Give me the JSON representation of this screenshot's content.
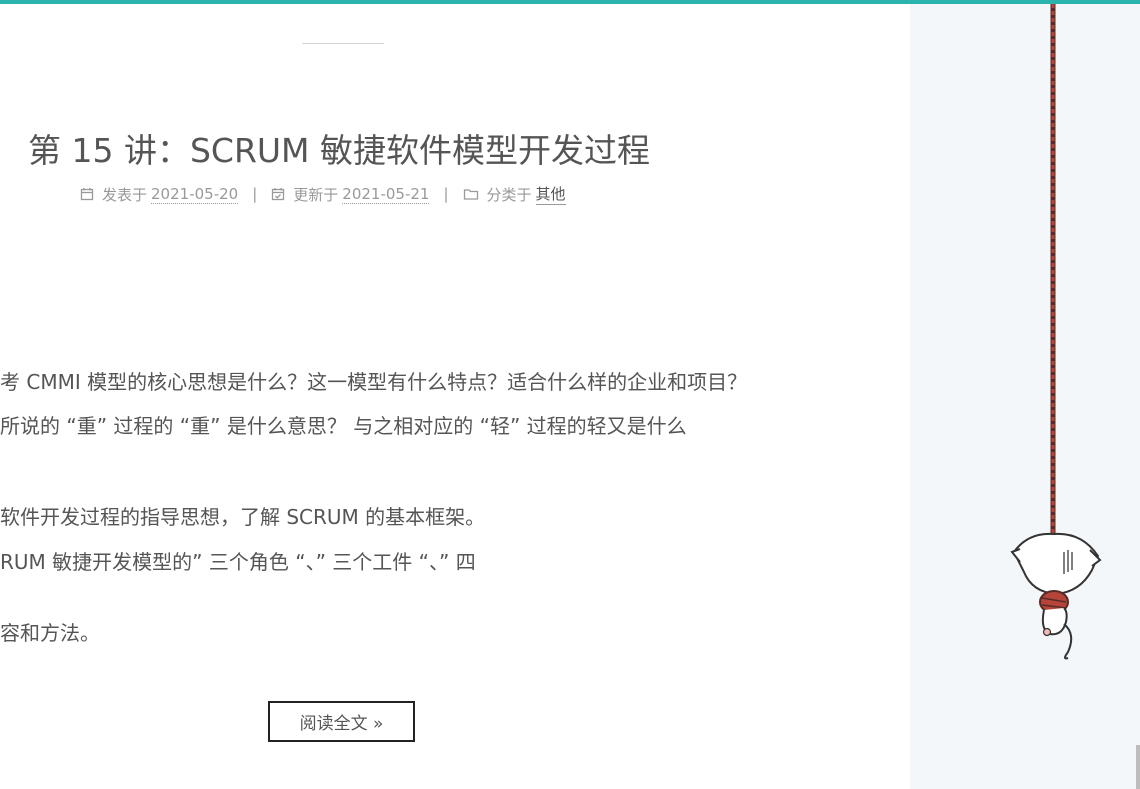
{
  "post": {
    "title": "第 15 讲：SCRUM 敏捷软件模型开发过程",
    "meta": {
      "posted_label": "发表于",
      "posted_date": "2021-05-20",
      "updated_label": "更新于",
      "updated_date": "2021-05-21",
      "category_label": "分类于",
      "category": "其他",
      "separator": "|"
    },
    "excerpt": [
      "考 CMMI 模型的核心思想是什么？这一模型有什么特点？适合什么样的企业和项目？",
      "所说的 “重” 过程的 “重” 是什么意思？ 与之相对应的 “轻” 过程的轻又是什么",
      "软件开发过程的指导思想，了解 SCRUM 的基本框架。",
      "RUM 敏捷开发模型的” 三个角色 “、” 三个工件 “、” 四",
      "容和方法。"
    ],
    "read_more_label": "阅读全文 »"
  },
  "icons": {
    "posted": "calendar-icon",
    "updated": "calendar-check-icon",
    "category": "folder-icon"
  },
  "colors": {
    "accent": "#2bb3ad",
    "text": "#555555",
    "meta": "#999999",
    "sidebar": "#f4f7fa",
    "rope": "#a33a2c"
  }
}
